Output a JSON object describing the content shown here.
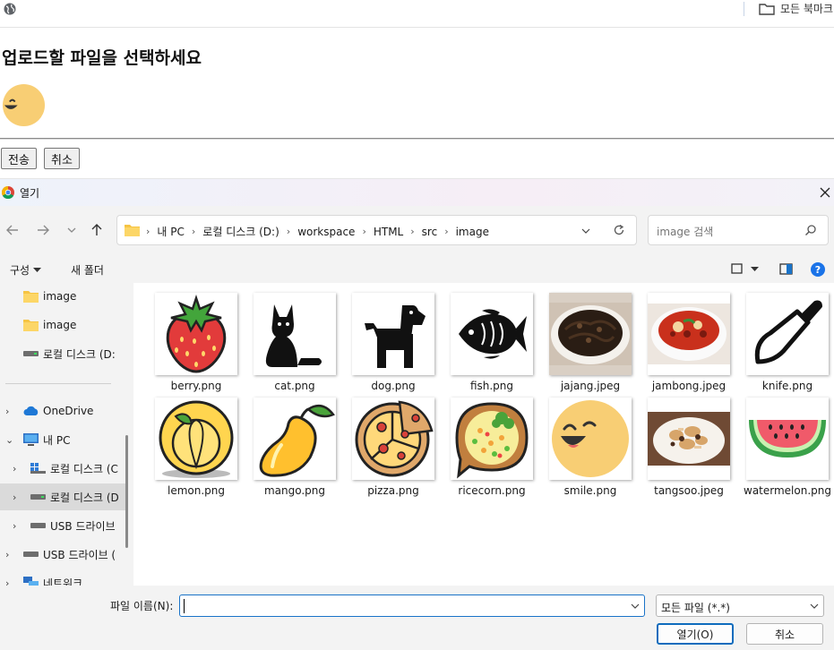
{
  "browser": {
    "bookmarks_folder": "모든 북마크"
  },
  "page": {
    "heading": "업로드할 파일을 선택하세요",
    "submit_label": "전송",
    "cancel_label": "취소"
  },
  "dialog": {
    "title": "열기",
    "breadcrumb": [
      "내 PC",
      "로컬 디스크 (D:)",
      "workspace",
      "HTML",
      "src",
      "image"
    ],
    "search_placeholder": "image 검색",
    "organize_label": "구성",
    "new_folder_label": "새 폴더",
    "nav_items": [
      {
        "label": "image",
        "icon": "folder-icon",
        "expand": "",
        "selected": false
      },
      {
        "label": "image",
        "icon": "folder-icon",
        "expand": "",
        "selected": false
      },
      {
        "label": "로컬 디스크 (D:",
        "icon": "drive-icon",
        "expand": "",
        "selected": false
      },
      {
        "label": "OneDrive",
        "icon": "cloud-icon",
        "expand": "›",
        "selected": false
      },
      {
        "label": "내 PC",
        "icon": "pc-icon",
        "expand": "⌄",
        "selected": false
      },
      {
        "label": "로컬 디스크 (C",
        "icon": "windows-drive-icon",
        "expand": "›",
        "selected": false
      },
      {
        "label": "로컬 디스크 (D",
        "icon": "drive-icon",
        "expand": "›",
        "selected": true
      },
      {
        "label": "USB 드라이브",
        "icon": "usb-drive-icon",
        "expand": "›",
        "selected": false
      },
      {
        "label": "USB 드라이브 (",
        "icon": "usb-drive-icon",
        "expand": "›",
        "selected": false
      },
      {
        "label": "네트워크",
        "icon": "network-icon",
        "expand": "›",
        "selected": false
      }
    ],
    "files": [
      {
        "name": "berry.png",
        "icon": "strawberry-icon"
      },
      {
        "name": "cat.png",
        "icon": "cat-icon"
      },
      {
        "name": "dog.png",
        "icon": "dog-icon"
      },
      {
        "name": "fish.png",
        "icon": "fish-icon"
      },
      {
        "name": "jajang.jpeg",
        "icon": "jajang-photo"
      },
      {
        "name": "jambong.jpeg",
        "icon": "jambong-photo"
      },
      {
        "name": "knife.png",
        "icon": "knife-icon"
      },
      {
        "name": "lemon.png",
        "icon": "lemon-icon"
      },
      {
        "name": "mango.png",
        "icon": "mango-icon"
      },
      {
        "name": "pizza.png",
        "icon": "pizza-icon"
      },
      {
        "name": "ricecorn.png",
        "icon": "ricecorn-icon"
      },
      {
        "name": "smile.png",
        "icon": "smile-icon"
      },
      {
        "name": "tangsoo.jpeg",
        "icon": "tangsoo-photo"
      },
      {
        "name": "watermelon.png",
        "icon": "watermelon-icon"
      }
    ],
    "filename_label": "파일 이름(N):",
    "filename_value": "",
    "filetype_value": "모든 파일 (*.*)",
    "open_label": "열기(O)",
    "cancel_label": "취소"
  },
  "colors": {
    "accent": "#0f6cbd",
    "folder": "#f6c443",
    "help": "#1a73e8"
  }
}
